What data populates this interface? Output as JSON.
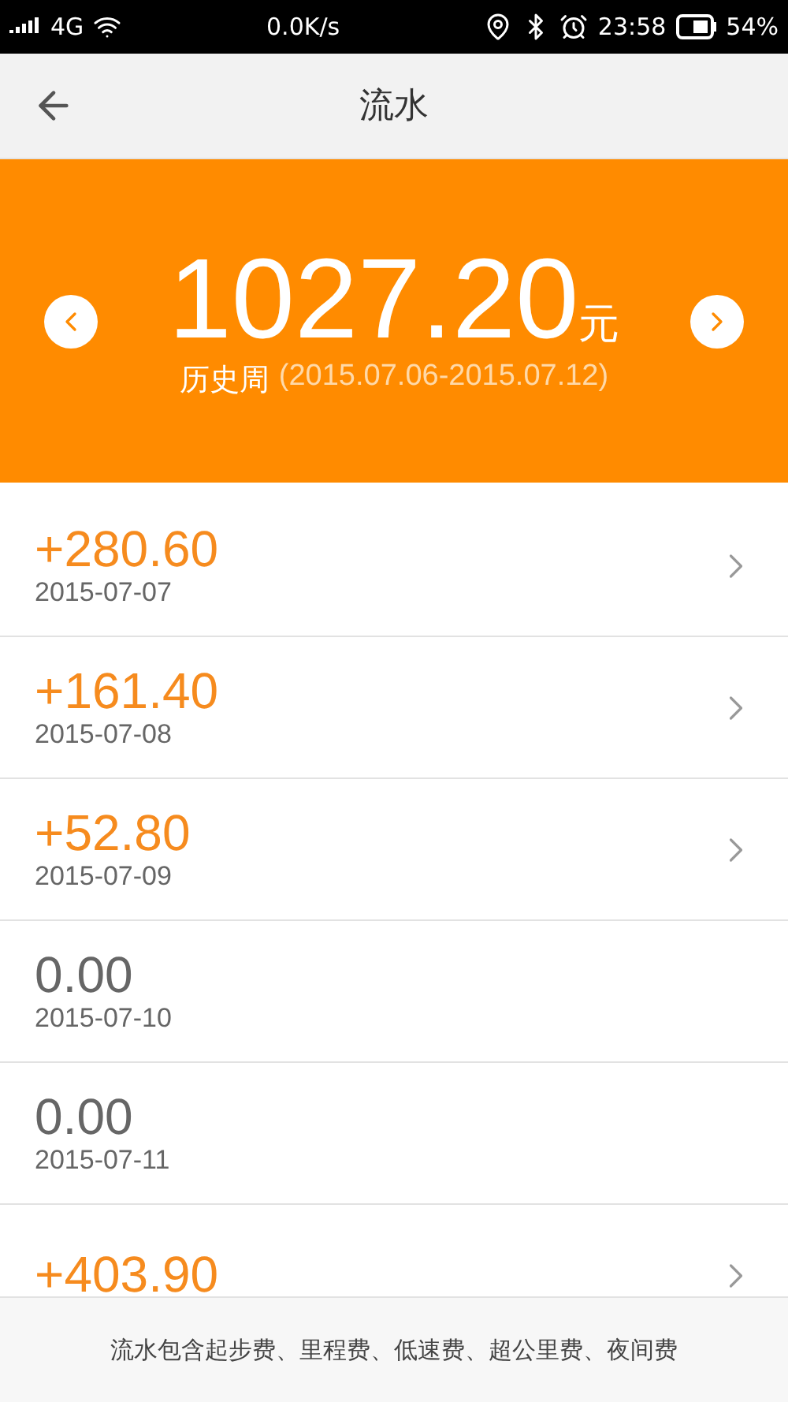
{
  "status_bar": {
    "network": "4G",
    "speed": "0.0K/s",
    "time": "23:58",
    "battery": "54%"
  },
  "nav": {
    "title": "流水"
  },
  "summary": {
    "amount": "1027.20",
    "unit": "元",
    "period_label": "历史周",
    "period": "(2015.07.06-2015.07.12)"
  },
  "entries": [
    {
      "kind": "income",
      "amount": "+280.60",
      "date": "2015-07-07"
    },
    {
      "kind": "income",
      "amount": "+161.40",
      "date": "2015-07-08"
    },
    {
      "kind": "income",
      "amount": "+52.80",
      "date": "2015-07-09"
    },
    {
      "kind": "zero",
      "amount": "0.00",
      "date": "2015-07-10"
    },
    {
      "kind": "zero",
      "amount": "0.00",
      "date": "2015-07-11"
    },
    {
      "kind": "income",
      "amount": "+403.90"
    }
  ],
  "footer": {
    "note": "流水包含起步费、里程费、低速费、超公里费、夜间费"
  }
}
